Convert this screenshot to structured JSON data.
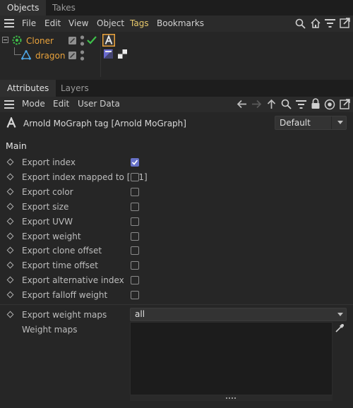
{
  "objects_manager": {
    "tabs": [
      "Objects",
      "Takes"
    ],
    "menu": [
      "File",
      "Edit",
      "View",
      "Object",
      "Tags",
      "Bookmarks"
    ],
    "items": [
      {
        "name": "Cloner"
      },
      {
        "name": "dragon"
      }
    ]
  },
  "attributes": {
    "tabs": [
      "Attributes",
      "Layers"
    ],
    "menu": [
      "Mode",
      "Edit",
      "User Data"
    ],
    "title": "Arnold MoGraph tag [Arnold MoGraph]",
    "preset": "Default",
    "section": "Main",
    "params": [
      {
        "label": "Export index",
        "checked": true
      },
      {
        "label": "Export index mapped to [0-1]",
        "checked": false
      },
      {
        "label": "Export color",
        "checked": false
      },
      {
        "label": "Export size",
        "checked": false
      },
      {
        "label": "Export UVW",
        "checked": false
      },
      {
        "label": "Export weight",
        "checked": false
      },
      {
        "label": "Export clone offset",
        "checked": false
      },
      {
        "label": "Export time offset",
        "checked": false
      },
      {
        "label": "Export alternative index",
        "checked": false
      },
      {
        "label": "Export falloff weight",
        "checked": false
      }
    ],
    "weight_maps_mode_label": "Export weight maps",
    "weight_maps_mode_value": "all",
    "weight_maps_label": "Weight maps"
  },
  "colors": {
    "accent_orange": "#e9a23b",
    "checkbox_on": "#6771c7",
    "check_green": "#3ec04a",
    "menu_highlight": "#e8c96b"
  }
}
